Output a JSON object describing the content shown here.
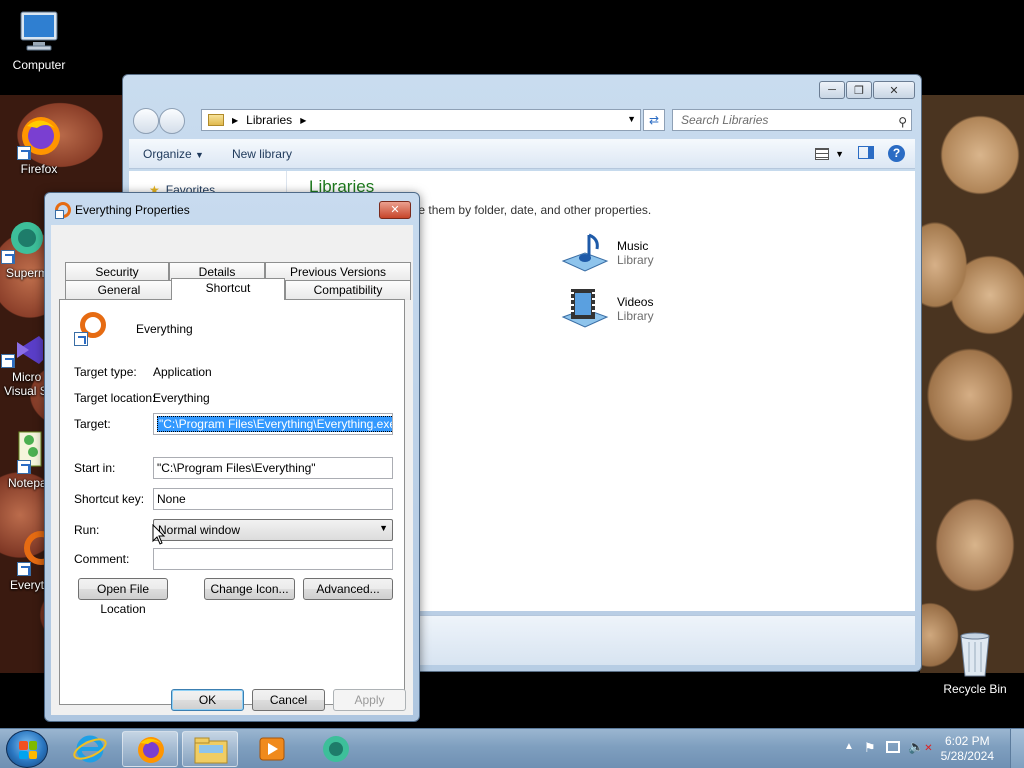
{
  "desktop": {
    "icons": [
      {
        "label": "Computer"
      },
      {
        "label": "Firefox"
      },
      {
        "label": "Superm"
      },
      {
        "label": "Micro"
      },
      {
        "label": "Visual S"
      },
      {
        "label": "Notepa"
      },
      {
        "label": "Everyt"
      },
      {
        "label": "Recycle Bin"
      }
    ]
  },
  "explorer": {
    "address": "Libraries",
    "search_placeholder": "Search Libraries",
    "toolbar": {
      "organize": "Organize",
      "new_library": "New library"
    },
    "nav": {
      "favorites": "Favorites"
    },
    "content": {
      "title": "Libraries",
      "description": "your files and arrange them by folder, date, and other properties.",
      "items": [
        {
          "name": "Music",
          "type": "Library"
        },
        {
          "name": "Videos",
          "type": "Library"
        }
      ]
    }
  },
  "dialog": {
    "title": "Everything Properties",
    "tabs_top": [
      "Security",
      "Details",
      "Previous Versions"
    ],
    "tabs_bottom": [
      "General",
      "Shortcut",
      "Compatibility"
    ],
    "active_tab": "Shortcut",
    "app_name": "Everything",
    "target_type_label": "Target type:",
    "target_type": "Application",
    "target_location_label": "Target location:",
    "target_location": "Everything",
    "target_label": "Target:",
    "target": "\"C:\\Program Files\\Everything\\Everything.exe\"",
    "start_in_label": "Start in:",
    "start_in": "\"C:\\Program Files\\Everything\"",
    "shortcut_key_label": "Shortcut key:",
    "shortcut_key": "None",
    "run_label": "Run:",
    "run": "Normal window",
    "comment_label": "Comment:",
    "comment": "",
    "buttons": {
      "open_location": "Open File Location",
      "change_icon": "Change Icon...",
      "advanced": "Advanced...",
      "ok": "OK",
      "cancel": "Cancel",
      "apply": "Apply"
    }
  },
  "taskbar": {
    "time": "6:02 PM",
    "date": "5/28/2024"
  },
  "colors": {
    "accent": "#3399ff",
    "library_title": "#1e7a1e",
    "everything_orange": "#e66b12"
  }
}
